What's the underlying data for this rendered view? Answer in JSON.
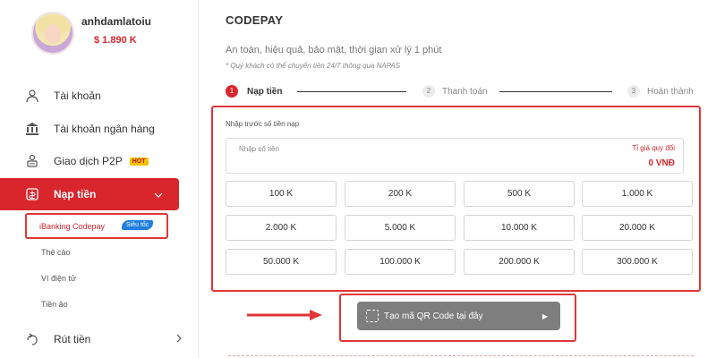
{
  "user": {
    "name": "anhdamlatoiu",
    "balance": "$ 1.890 K"
  },
  "sidebar": {
    "items": [
      {
        "label": "Tài khoản",
        "icon": "user-icon"
      },
      {
        "label": "Tài khoản ngân hàng",
        "icon": "bank-icon"
      },
      {
        "label": "Giao dịch P2P",
        "icon": "p2p-icon",
        "badge": "HOT"
      },
      {
        "label": "Nạp tiền",
        "icon": "deposit-icon",
        "active": true
      },
      {
        "label": "Rút tiền",
        "icon": "withdraw-icon"
      }
    ],
    "sub_items": {
      "active": "iBanking Codepay",
      "active_badge": "Siêu tốc",
      "others": [
        "Thẻ cào",
        "Ví điện tử",
        "Tiền ảo"
      ]
    }
  },
  "main": {
    "title": "CODEPAY",
    "subtitle": "An toàn, hiệu quả, bảo mật, thời gian xử lý 1 phút",
    "note": "* Quý khách có thể chuyển tiền 24/7 thông qua NAPAS",
    "steps": [
      {
        "num": "1",
        "label": "Nạp tiền",
        "active": true
      },
      {
        "num": "2",
        "label": "Thanh toán",
        "active": false
      },
      {
        "num": "3",
        "label": "Hoàn thành",
        "active": false
      }
    ],
    "deposit": {
      "section_label": "Nhập trước số tiền nạp",
      "placeholder": "Nhập số tiền",
      "rate_label": "Tỉ giá quy đổi",
      "rate_value": "0 VNĐ",
      "amounts": [
        "100 K",
        "200 K",
        "500 K",
        "1.000 K",
        "2.000 K",
        "5.000 K",
        "10.000 K",
        "20.000 K",
        "50.000 K",
        "100.000 K",
        "200.000 K",
        "300.000 K"
      ]
    },
    "qr_button": "Tạo mã QR Code tại đây"
  },
  "colors": {
    "accent": "#d9262d",
    "highlight": "#e0363a",
    "button_gray": "#7e7e7e"
  }
}
